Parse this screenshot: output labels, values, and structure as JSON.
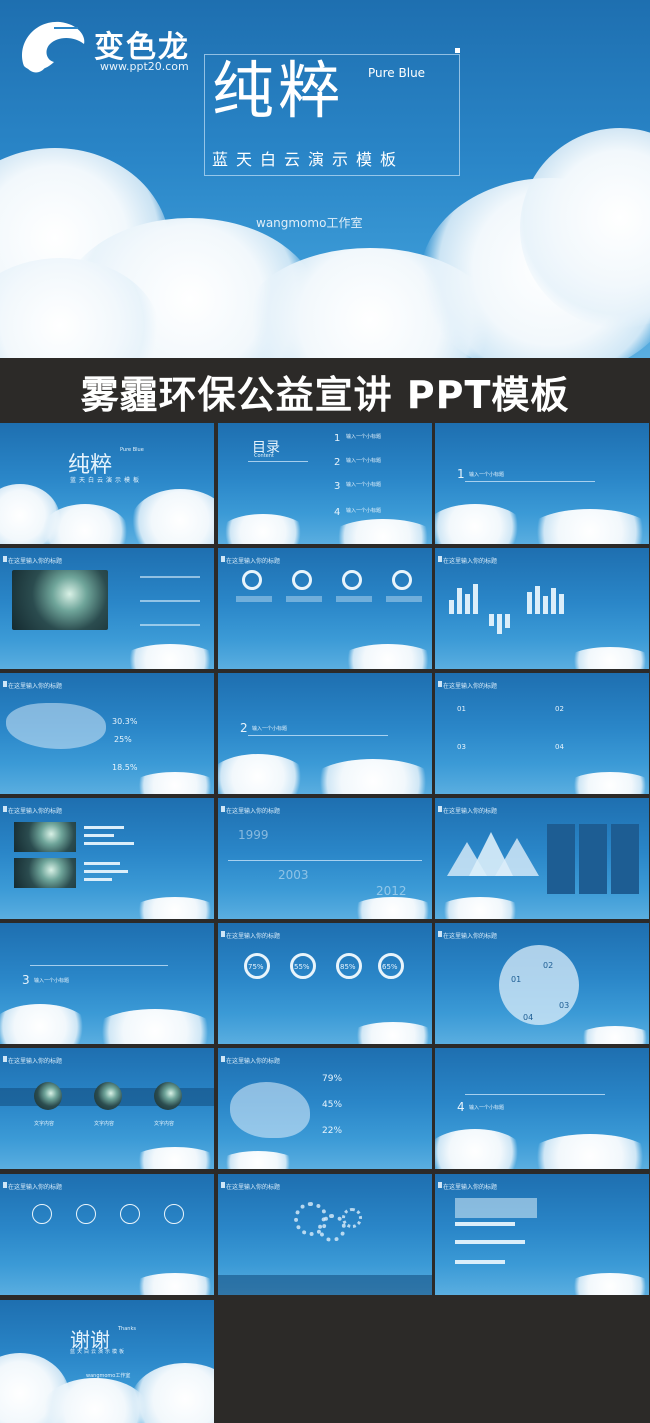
{
  "hero": {
    "brand": "变色龙",
    "url": "www.ppt20.com",
    "title": "纯粹",
    "title_en": "Pure Blue",
    "subtitle": "蓝天白云演示模板",
    "studio": "wangmomo工作室"
  },
  "banner": {
    "text": "雾霾环保公益宣讲 PPT模板"
  },
  "slides": {
    "s1": {
      "title": "纯粹",
      "title_en": "Pure Blue",
      "subtitle": "蓝天白云演示模板"
    },
    "s2": {
      "title": "目录",
      "title_en": "Content",
      "items": [
        "输入一个小标题",
        "输入一个小标题",
        "输入一个小标题",
        "输入一个小标题"
      ],
      "nums": [
        "1",
        "2",
        "3",
        "4"
      ]
    },
    "s3": {
      "num": "1",
      "label": "输入一个小标题"
    },
    "header": "在这里输入你的标题",
    "s8_pcts": [
      "30.3%",
      "25%",
      "18.5%"
    ],
    "s9": {
      "num": "2",
      "label": "输入一个小标题"
    },
    "s10": {
      "nums": [
        "01",
        "02",
        "03",
        "04"
      ]
    },
    "s12_years": [
      "1999",
      "2003",
      "2012"
    ],
    "s15": {
      "num": "3",
      "label": "输入一个小标题"
    },
    "s16_pcts": [
      "75%",
      "55%",
      "85%",
      "65%"
    ],
    "s17_nums": [
      "01",
      "02",
      "03",
      "04"
    ],
    "s18_labels": [
      "文字内容",
      "文字内容",
      "文字内容"
    ],
    "s19_pcts": [
      "79%",
      "45%",
      "22%"
    ],
    "s20": {
      "num": "4",
      "label": "输入一个小标题"
    },
    "thanks": {
      "title": "谢谢",
      "title_en": "Thanks",
      "subtitle": "蓝天白云演示模板",
      "studio": "wangmomo工作室"
    }
  }
}
